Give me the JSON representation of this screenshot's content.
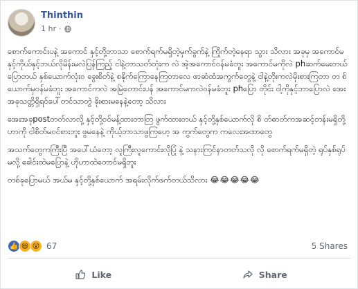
{
  "post": {
    "author": "Thinthin",
    "time": "1 hr",
    "privacy_icon": "globe-icon",
    "paragraphs": [
      "စောက်ကောင်းပနဲ့ အကောင် နှင့်တို့ဘာသာ စောက်ရက်မရှိတဲ့မှက်ခွက်နဲ့ ကြိုက်တဲ့နေရာ သွား သိလား အခုမှ အကောင်မနှင့်ကိုယ်နှင့်ဘယ်လိုမိန်းမလဲပြန်ကြည့် ငါနဲ့တာသတ်တုံးက လဲ အဲ့အကောင်ဝန်မခံဘူး အကောင်မကိုလဲ phဆက်မေးတယ်ပြောတယ် နှစ်ယောက်လုံးဝ ခွေးစိတ်နဲ့ စနိုက်ကြောနေကြတာလေ ဖာဆံထံအကွက်တွေနဲ့ ငါနဲ့တိုးကလဲမိုးစားကြတာ တ စ်ယောက်မှဝန်မခံဘူး အကောင်ကလဲ အမြဲတောင်းပန် အကောင်မကလဲဝန်မခံဘူး phပြော တိုင်း ငါ့ကိုနှင့်ဘာပြောလဲ အေးအခုသတ္တိရှိရင်ပေါ်တင်သာတွဲ ခိုးစားမနေနဲ့တော့ သိလား",
      "အေးအခုpostတတ်လာလို့ နှင့်တို့ဝင်မန့်ထားတာတြ ဖွက်ထားတယ် နှင့်တို့နှစ်ယောက်လို စိ တ်ဓာတ်ကအဆင့်တန်းမရှိတို့ဟာကို ငါစိတ်မဝင်စားဘူး ဖွမနေနဲ့ ကိုယ့်ဘာသာဖွကြဟေ့ အ ကွက်တွေက ကလေးအထာတွေ",
      "အသက်တွေကကြီးပြီ အပေါ်ယံတော့ လူကြီးလူကောင်းလိုပြုံ နဲ့ သနားကြင်နာတတ်သလို လို စောက်ရက်မရှိတဲ့ ရုပ်နှစ်ရုပ်မလို့ ခေါင်းထဲမပြောနဲ့ ဟိုဟာထဲတောင်မရှိဘူး",
      "တစ်ခုပြောမယ် အယ်မ နှင့်တို့နှစ်ယောက် အရမ်းလိုက်ဖက်တယ်သိလား"
    ],
    "emojis": "😂😂😂😂😂"
  },
  "reactions": {
    "icons": [
      "like-icon",
      "haha-icon",
      "wow-icon"
    ],
    "count": "67",
    "shares": "5 Shares"
  },
  "actions": {
    "like_label": "Like",
    "share_label": "Share"
  },
  "colors": {
    "name": "#365899",
    "like": "#4267b2",
    "haha": "#f7b125"
  }
}
